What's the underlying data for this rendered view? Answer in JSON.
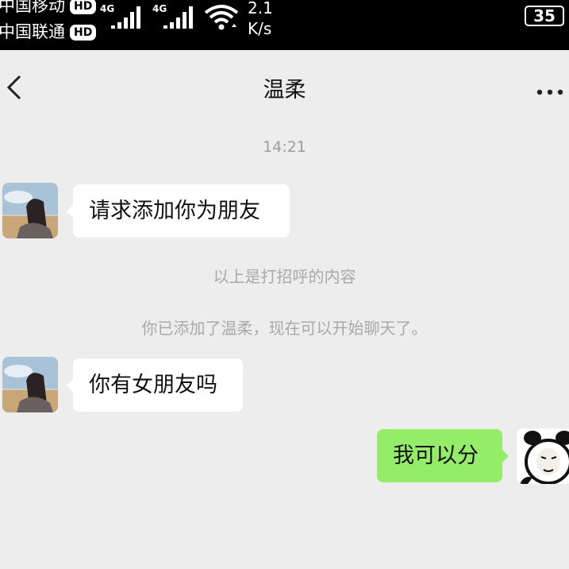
{
  "status_bar": {
    "carrier1": "中国移动",
    "carrier2": "中国联通",
    "hd1": "HD",
    "hd2": "HD",
    "network1": "4G",
    "network2": "4G",
    "speed_value": "2.1",
    "speed_unit": "K/s",
    "battery": "35"
  },
  "header": {
    "title": "温柔",
    "back_icon": "chevron-left-icon",
    "more_icon": "more-horizontal-icon"
  },
  "chat": {
    "timestamp": "14:21",
    "messages": [
      {
        "from": "contact",
        "text": "请求添加你为朋友"
      },
      {
        "from": "contact",
        "text": "你有女朋友吗"
      },
      {
        "from": "me",
        "text": "我可以分"
      }
    ],
    "system": [
      "以上是打招呼的内容",
      "你已添加了温柔，现在可以开始聊天了。"
    ]
  },
  "colors": {
    "background": "#ededed",
    "outgoing_bubble": "#95ec69",
    "incoming_bubble": "#ffffff",
    "status_bar": "#000000"
  }
}
